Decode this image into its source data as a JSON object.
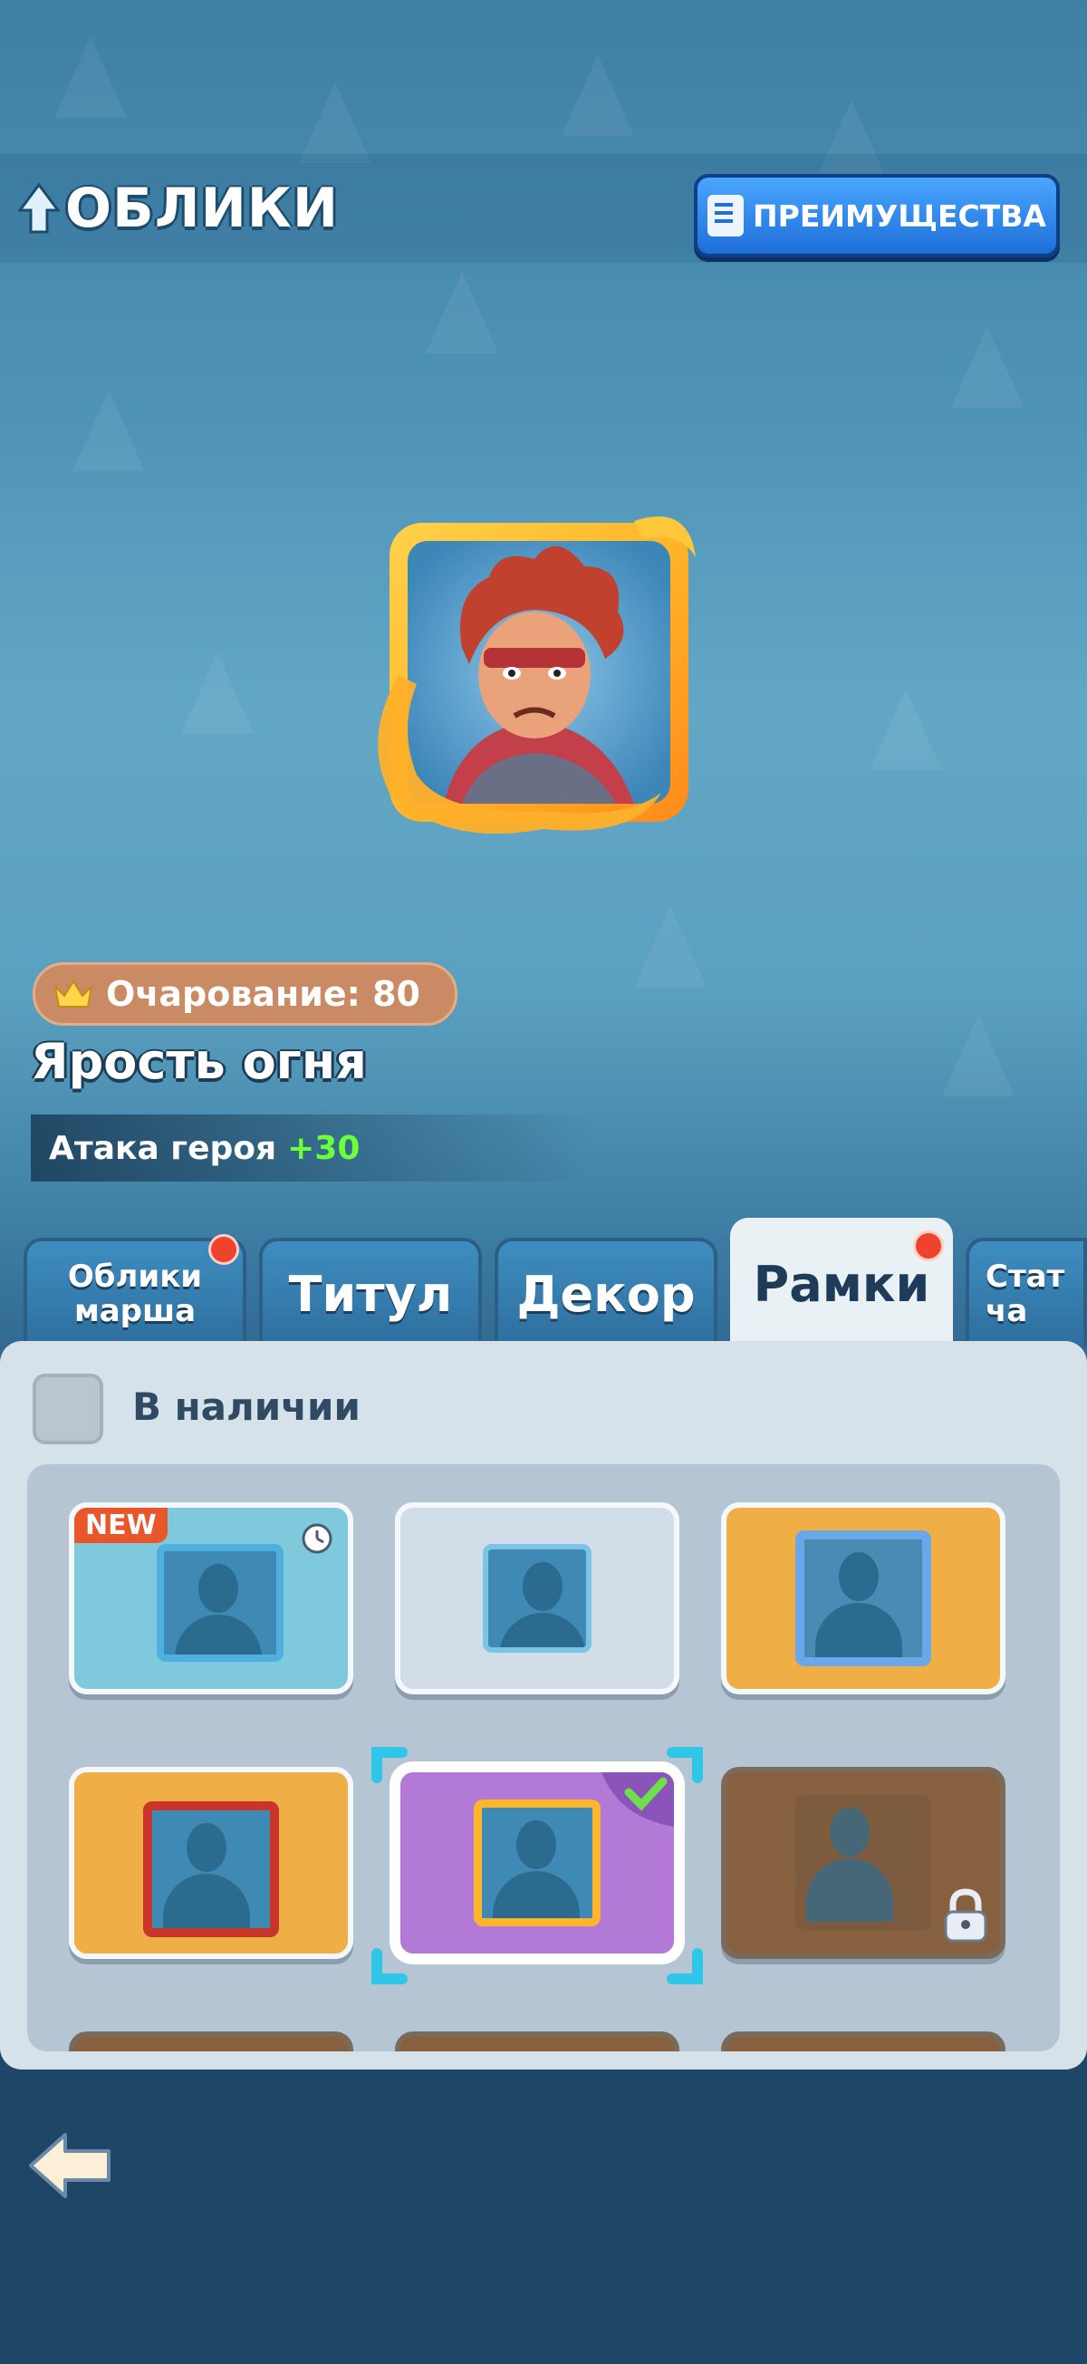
{
  "header": {
    "title": "ОБЛИКИ",
    "advantages_button": "ПРЕИМУЩЕСТВА"
  },
  "skin": {
    "charm_label": "Очарование: 80",
    "name": "Ярость огня",
    "attribute_label": "Атака героя",
    "attribute_value": "+30"
  },
  "tabs": [
    {
      "label": "Облики марша",
      "badge": true,
      "active": false
    },
    {
      "label": "Титул",
      "badge": false,
      "active": false
    },
    {
      "label": "Декор",
      "badge": false,
      "active": false
    },
    {
      "label": "Рамки",
      "badge": true,
      "active": true
    },
    {
      "label": "Стат ча",
      "badge": false,
      "active": false
    }
  ],
  "filter": {
    "available_label": "В наличии",
    "checked": false
  },
  "frames": [
    {
      "name": "ocean-frame",
      "badge": "NEW",
      "timer": true,
      "bg": "#7ec9dc"
    },
    {
      "name": "basic-frame",
      "bg": "#d2dee7"
    },
    {
      "name": "ice-dragon-frame",
      "bg": "#f0ae46"
    },
    {
      "name": "chinese-lion-frame",
      "bg": "#f0ae46"
    },
    {
      "name": "fire-fury-frame",
      "selected": true,
      "equipped": true,
      "bg": "#b27ad6"
    },
    {
      "name": "tropical-frame",
      "locked": true,
      "bg": "#86603f"
    }
  ],
  "colors": {
    "accent_blue": "#1e6fd9",
    "charm_badge": "#c98a64",
    "bonus_green": "#6cff3a",
    "notification_red": "#f0432e"
  }
}
